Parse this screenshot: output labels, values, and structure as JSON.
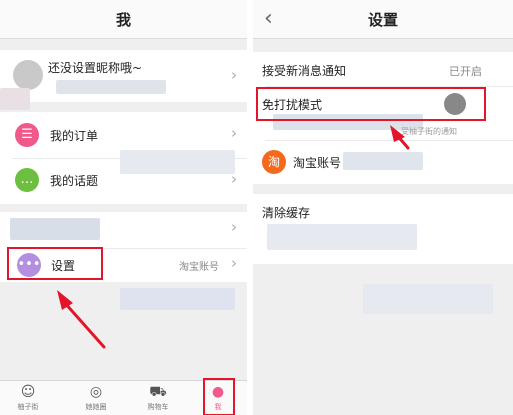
{
  "left": {
    "title": "我",
    "profile": {
      "nickname": "还没设置昵称哦~"
    },
    "menu": {
      "orders": "我的订单",
      "topics": "我的话题",
      "settings": "设置",
      "taobao_account": "淘宝账号"
    },
    "tabbar": [
      {
        "label": "柚子街",
        "icon": "shopping-bag-icon",
        "glyph": "☺"
      },
      {
        "label": "她她圈",
        "icon": "magnifier-icon",
        "glyph": "◎"
      },
      {
        "label": "购物车",
        "icon": "cart-icon",
        "glyph": "⛟"
      },
      {
        "label": "我",
        "icon": "user-icon",
        "glyph": "●",
        "active": true
      }
    ]
  },
  "right": {
    "title": "设置",
    "back_glyph": "‹",
    "notify": {
      "label": "接受新消息通知",
      "status": "已开启"
    },
    "dnd": {
      "label": "免打扰模式",
      "hint": "受柚子街的通知"
    },
    "taobao": {
      "label": "淘宝账号",
      "icon_glyph": "淘"
    },
    "clear_cache": "清除缓存"
  },
  "colors": {
    "annotation_red": "#e3152a",
    "accent_pink": "#f05a8a",
    "green": "#6cbf3f",
    "toggle_off": "#888888"
  }
}
